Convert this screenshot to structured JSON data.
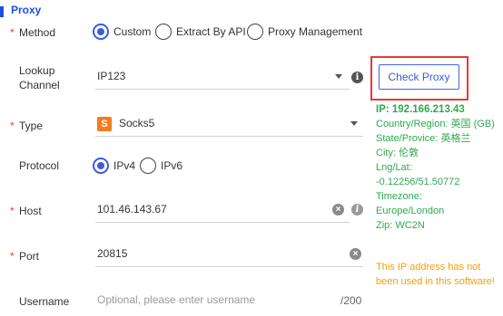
{
  "section": {
    "title": "Proxy"
  },
  "method": {
    "label": "Method",
    "options": [
      "Custom",
      "Extract By API",
      "Proxy Management"
    ],
    "selected": "Custom"
  },
  "lookup": {
    "label_line1": "Lookup",
    "label_line2": "Channel",
    "value": "IP123"
  },
  "type": {
    "label": "Type",
    "value": "Socks5",
    "icon_letter": "S"
  },
  "protocol": {
    "label": "Protocol",
    "options": [
      "IPv4",
      "IPv6"
    ],
    "selected": "IPv4"
  },
  "host": {
    "label": "Host",
    "value": "101.46.143.67"
  },
  "port": {
    "label": "Port",
    "value": "20815"
  },
  "username": {
    "label": "Username",
    "placeholder": "Optional, please enter username",
    "counter": "/200"
  },
  "check_proxy": {
    "label": "Check Proxy"
  },
  "proxy_info": {
    "ip": "IP:  192.166.213.43",
    "country": "Country/Region: 英国 (GB)",
    "state": "State/Provice: 英格兰",
    "city": "City: 伦敦",
    "lnglat_label": "Lng/Lat:",
    "lnglat": "-0.12256/51.50772",
    "timezone_label": "Timezone:",
    "timezone": "Europe/London",
    "zip": "Zip: WC2N"
  },
  "warning": "This IP address has not been used in this software!",
  "colors": {
    "accent": "#3b5bdb",
    "required": "#e53935",
    "success": "#2fa84f",
    "warning": "#f2a007",
    "highlight": "#e53935"
  },
  "icons": {
    "dropdown": "chevron-down-icon",
    "info": "info-icon",
    "clear": "clear-icon",
    "socks": "socks5-icon"
  }
}
